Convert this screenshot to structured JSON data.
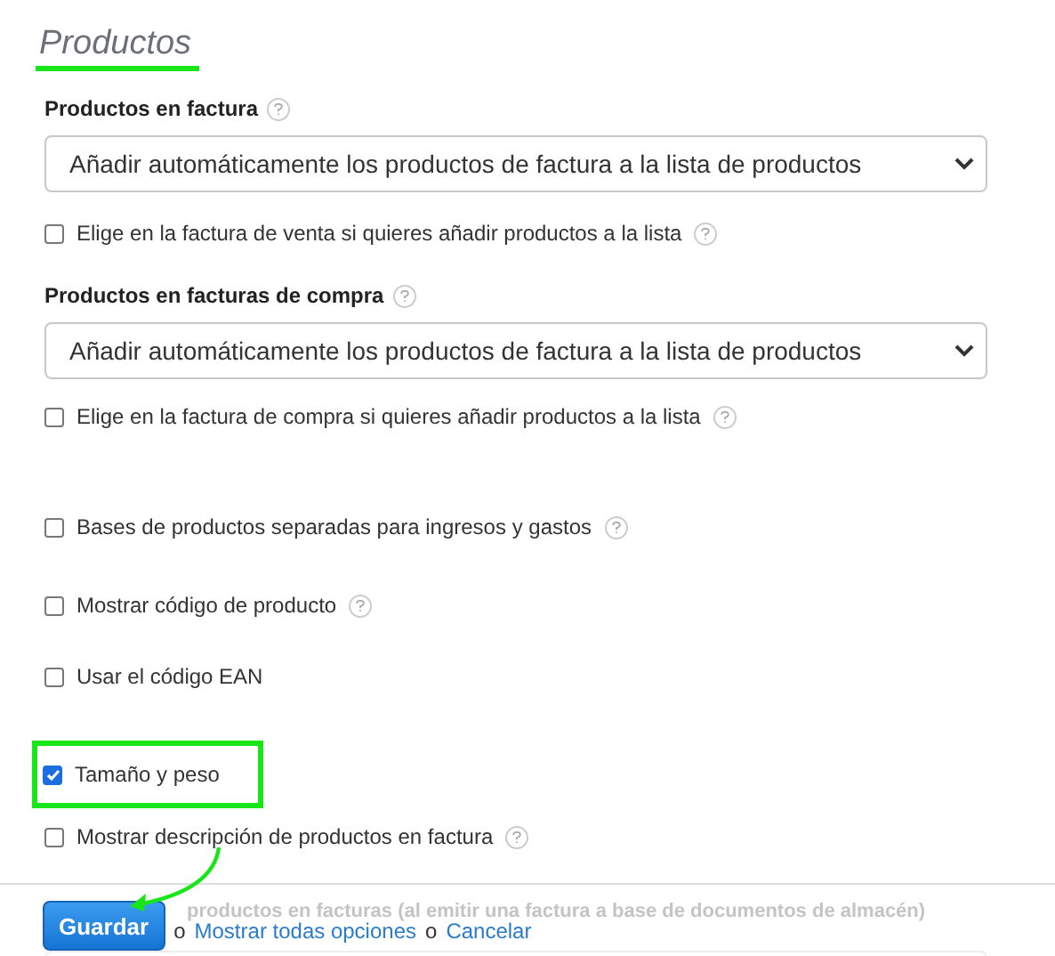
{
  "title": "Productos",
  "items": [
    {
      "kind": "select",
      "label": "Productos en factura",
      "help": true,
      "value": "Añadir automáticamente los productos de factura a la lista de productos"
    },
    {
      "kind": "checkbox",
      "label": "Elige en la factura de venta si quieres añadir productos a la lista",
      "help": true,
      "checked": false,
      "highlighted": false
    },
    {
      "kind": "select",
      "label": "Productos en facturas de compra",
      "help": true,
      "value": "Añadir automáticamente los productos de factura a la lista de productos"
    },
    {
      "kind": "checkbox",
      "label": "Elige en la factura de compra si quieres añadir productos a la lista",
      "help": true,
      "checked": false,
      "highlighted": false
    },
    {
      "kind": "checkbox",
      "label": "Bases de productos separadas para ingresos y gastos",
      "help": true,
      "checked": false,
      "highlighted": false
    },
    {
      "kind": "checkbox",
      "label": "Mostrar código de producto",
      "help": true,
      "checked": false,
      "highlighted": false
    },
    {
      "kind": "checkbox",
      "label": "Usar el código EAN",
      "help": false,
      "checked": false,
      "highlighted": false
    },
    {
      "kind": "checkbox",
      "label": "Tamaño y peso",
      "help": false,
      "checked": true,
      "highlighted": true
    },
    {
      "kind": "checkbox",
      "label": "Mostrar descripción de productos en factura",
      "help": true,
      "checked": false,
      "highlighted": false
    }
  ],
  "behind_footer": {
    "label": "productos en facturas (al emitir una factura a base de documentos de almacén)"
  },
  "footer": {
    "save": "Guardar",
    "sep1": "o",
    "show_all": "Mostrar todas opciones",
    "sep2": "o",
    "cancel": "Cancelar"
  }
}
